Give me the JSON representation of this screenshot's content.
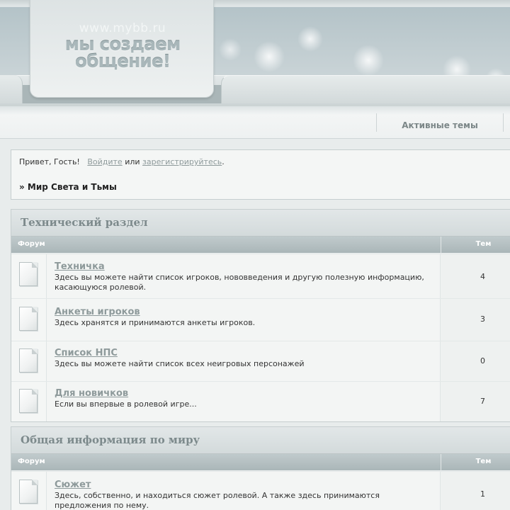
{
  "logo": {
    "url": "www.mybb.ru",
    "line1": "мы создаем",
    "line2": "общение!"
  },
  "navbar": {
    "active_topics": "Активные темы"
  },
  "welcome": {
    "greeting": "Привет, Гость!",
    "login": "Войдите",
    "or": "или",
    "register": "зарегистрируйтесь",
    "period": "."
  },
  "breadcrumb": "» Мир Света и Тьмы",
  "categories": [
    {
      "title": "Технический раздел",
      "col_forum": "Форум",
      "col_topics": "Тем",
      "forums": [
        {
          "name": "Техничка",
          "desc": "Здесь вы можете найти список игроков, нововведения и другую полезную информацию, касающуюся ролевой.",
          "topics": "4"
        },
        {
          "name": "Анкеты игроков",
          "desc": "Здесь хранятся и принимаются анкеты игроков.",
          "topics": "3"
        },
        {
          "name": "Список НПС",
          "desc": "Здесь вы можете найти список всех неигровых персонажей",
          "topics": "0"
        },
        {
          "name": "Для новичков",
          "desc": "Если вы впервые в ролевой игре...",
          "topics": "7"
        }
      ]
    },
    {
      "title": "Общая информация по миру",
      "col_forum": "Форум",
      "col_topics": "Тем",
      "forums": [
        {
          "name": "Сюжет",
          "desc": "Здесь, собственно, и находиться сюжет ролевой. А также здесь принимаются предложения по нему.",
          "topics": "1"
        }
      ]
    }
  ]
}
